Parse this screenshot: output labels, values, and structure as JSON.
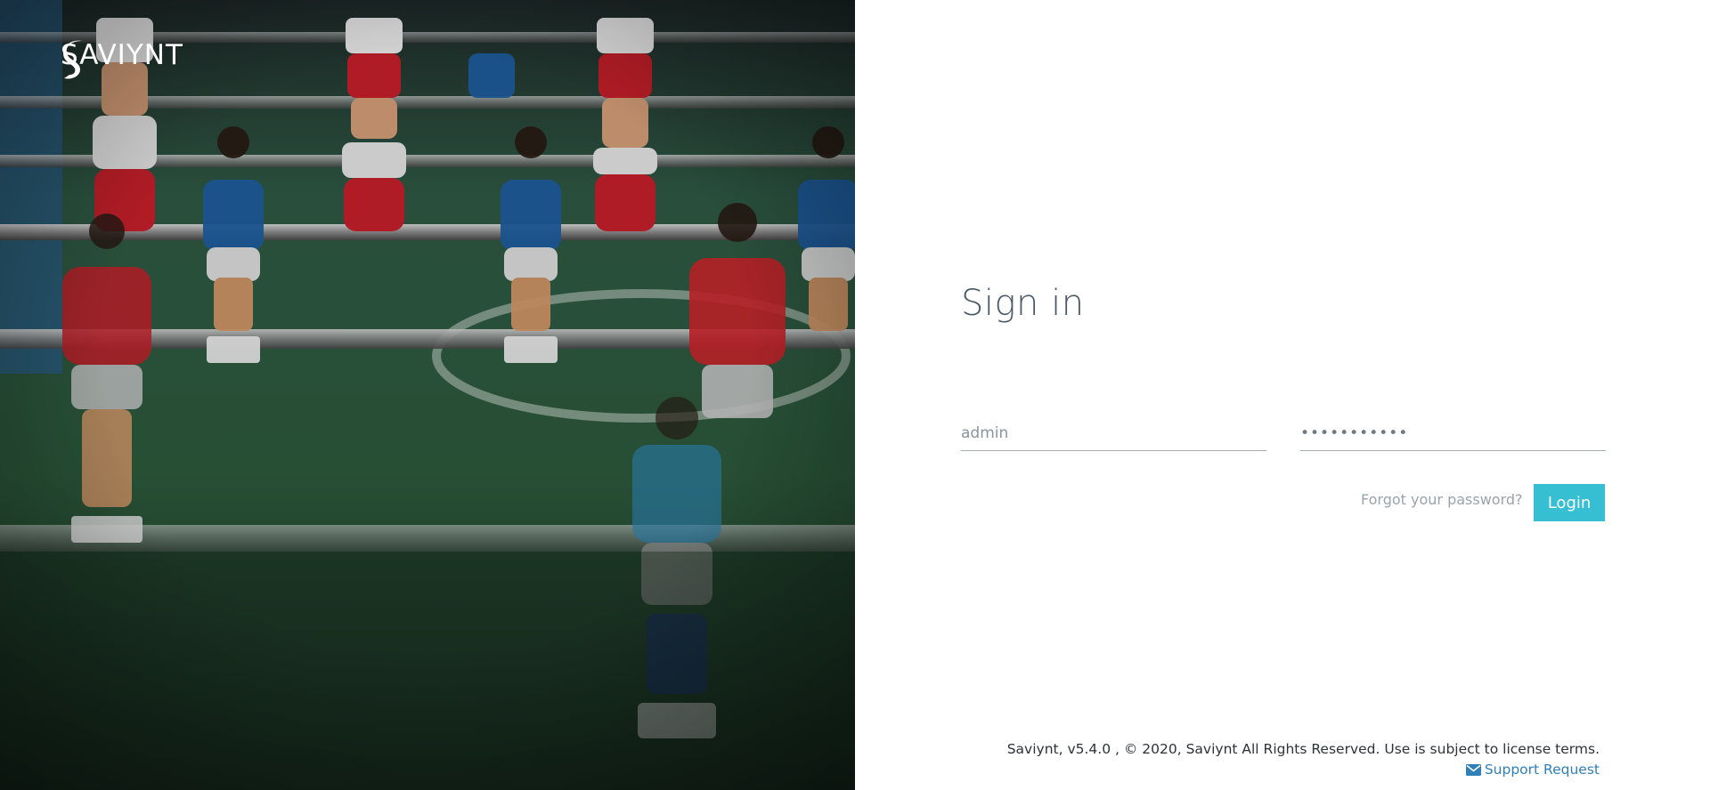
{
  "brand": {
    "logo_text": "SAVIYNT"
  },
  "signin": {
    "title": "Sign in",
    "username_value": "admin",
    "password_value": "•••••••••••",
    "forgot_label": "Forgot your password?",
    "login_label": "Login"
  },
  "footer": {
    "copyright": "Saviynt, v5.4.0 , © 2020, Saviynt All Rights Reserved. Use is subject to license terms.",
    "support_label": "Support Request"
  },
  "icons": {
    "support": "envelope-icon",
    "brand": "saviynt-logo-mark"
  },
  "colors": {
    "accent": "#36bfd3",
    "title": "#4a5a66",
    "link": "#2f7fb8"
  }
}
